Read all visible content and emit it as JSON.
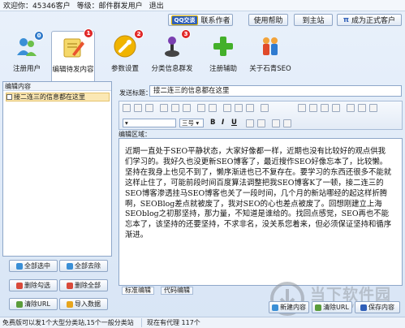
{
  "topbar": {
    "welcome": "欢迎你：",
    "customer": "45346客户",
    "level": "等级：邮件群发用户",
    "logout": "退出"
  },
  "header_buttons": {
    "qq_badge": "QQ交谈",
    "contact": "联系作者",
    "help": "使用帮助",
    "site": "到主站",
    "upgrade": "成为正式客户"
  },
  "tools": [
    {
      "label": "注册用户",
      "badge": "0"
    },
    {
      "label": "编辑待发内容",
      "badge": "1"
    },
    {
      "label": "参数设置",
      "badge": "2"
    },
    {
      "label": "分类信息群发",
      "badge": "3"
    },
    {
      "label": "注册辅助",
      "badge": ""
    },
    {
      "label": "关于石青SEO",
      "badge": ""
    }
  ],
  "left": {
    "title": "编辑内容",
    "item": "接二连三的信息都在这里",
    "buttons": {
      "select_all": "全部选中",
      "deselect_all": "全部去除",
      "delete_checked": "删除勾选",
      "delete_all": "删除全部",
      "clear_url": "清除URL",
      "import": "导入数据"
    }
  },
  "editor": {
    "send_title_label": "发送标题：",
    "title_value": "接二连三的信息都在这里",
    "font_size": "三号",
    "edit_area_label": "编辑区域：",
    "content": "近期一直处于SEO平静状态，大家好像都一样，近期也没有比较好的观点供我们学习的。我好久也没更新SEO博客了，最近搜作SEO好像忘本了，比较懒。坚持在我身上也见不到了，懒序渐进也已不复存在。要学习的东西还很多不能就这样止住了，可能前段时间百度算法调整把我SEO博客K了一顿，接二连三的SEO博客渗透挂马SEO博客也关了一段时间，几个月的新站哪经的起这样折腾啊，SEOBlog差点就被废了，我对SEO的心也差点被废了。回想刚建立上海SEOblog之初那坚持，那力量，不知道是谁给的。找回点感觉，SEO再也不能忘本了，该坚持的还要坚持，不求非名，没关系您着来，但必须保证坚持和循序渐进。",
    "tabs": [
      "标准编辑",
      "代码编辑"
    ],
    "buttons": {
      "new": "新建内容",
      "clear_url": "清除URL",
      "save": "保存内容"
    }
  },
  "status": {
    "left": "免费版可以发1个大型分类站,15个一般分类站",
    "right": "现在有代理 117个"
  },
  "watermark": {
    "text": "当下软件园",
    "url": "www.downxia.com"
  },
  "colors": {
    "accent": "#2f5fb8",
    "badge_red": "#d40000",
    "selection": "#fbe8b4"
  }
}
